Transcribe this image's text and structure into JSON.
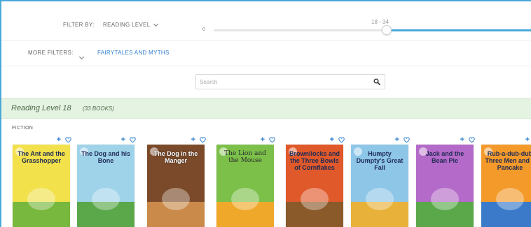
{
  "filters": {
    "filter_by_label": "FILTER BY:",
    "filter_select": "READING LEVEL",
    "slider_min": "0",
    "slider_range": "18 - 34",
    "more_filters_label": "MORE FILTERS:",
    "active_filter": "FAIRYTALES AND MYTHS",
    "colors": {
      "accent": "#4aa8d8",
      "link": "#2f7fd0"
    }
  },
  "search": {
    "placeholder": "Search",
    "icon": "search-icon"
  },
  "level": {
    "title": "Reading Level 18",
    "count": "(33 BOOKS)",
    "color": "#e5f3e2"
  },
  "section": {
    "label": "FICTION"
  },
  "book_actions": {
    "add": "+",
    "favorite_icon": "heart-icon"
  },
  "books": [
    {
      "title": "The Ant and the Grasshopper",
      "cover_bg": "#f2e14a",
      "accent": "#78b83e"
    },
    {
      "title": "The Dog and his Bone",
      "cover_bg": "#9fd3ea",
      "accent": "#5aa84a"
    },
    {
      "title": "The Dog in the Manger",
      "cover_bg": "#7a4a2a",
      "accent": "#c98a4a"
    },
    {
      "title": "The Lion and the Mouse",
      "cover_bg": "#7cc04a",
      "accent": "#f0a82a"
    },
    {
      "title": "Brownilocks and the Three Bowls of Cornflakes",
      "cover_bg": "#e0592a",
      "accent": "#8a5a2a"
    },
    {
      "title": "Humpty Dumpty's Great Fall",
      "cover_bg": "#8ec6e8",
      "accent": "#e8b23a"
    },
    {
      "title": "Jack and the Bean Pie",
      "cover_bg": "#b46ac8",
      "accent": "#5aa84a"
    },
    {
      "title": "Rub-a-dub-dub Three Men and a Pancake",
      "cover_bg": "#f39a2a",
      "accent": "#3a7ac8"
    }
  ]
}
